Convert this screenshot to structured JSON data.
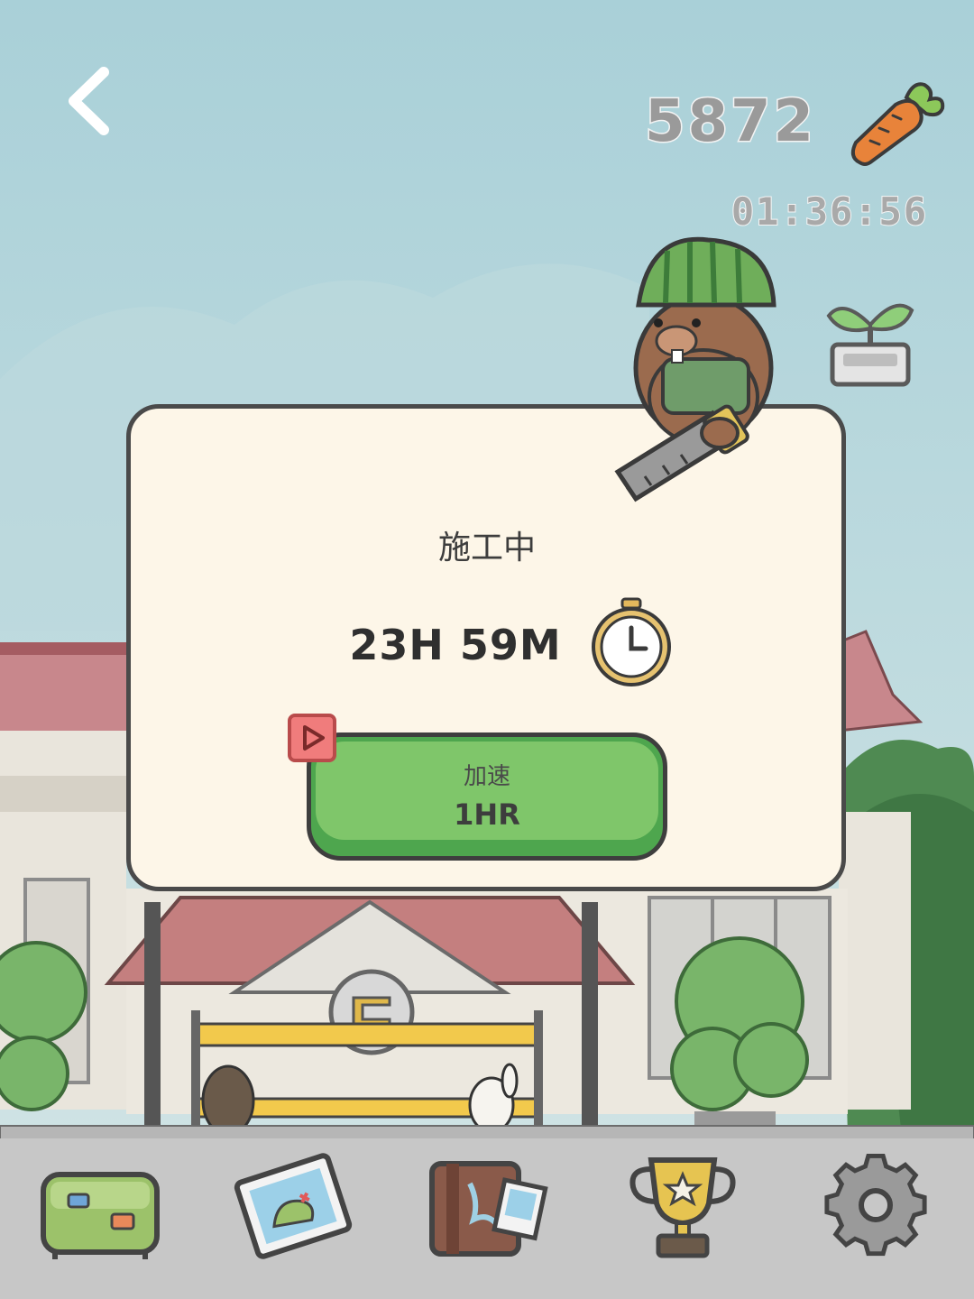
{
  "header": {
    "carrot_count": "5872",
    "timer": "01:36:56"
  },
  "dialog": {
    "title": "施工中",
    "remaining_time": "23H 59M",
    "speed_up_label": "加速",
    "speed_up_value": "1HR"
  },
  "icons": {
    "back": "back-arrow-icon",
    "carrot": "carrot-icon",
    "sprout": "sprout-pot-icon",
    "stopwatch": "stopwatch-icon",
    "ad": "video-ad-icon",
    "nav": [
      "suitcase-icon",
      "map-icon",
      "album-icon",
      "trophy-icon",
      "settings-gear-icon"
    ]
  },
  "colors": {
    "dialog_bg": "#fdf6e8",
    "speed_button": "#7fc66a",
    "ad_badge": "#f07c7c"
  }
}
